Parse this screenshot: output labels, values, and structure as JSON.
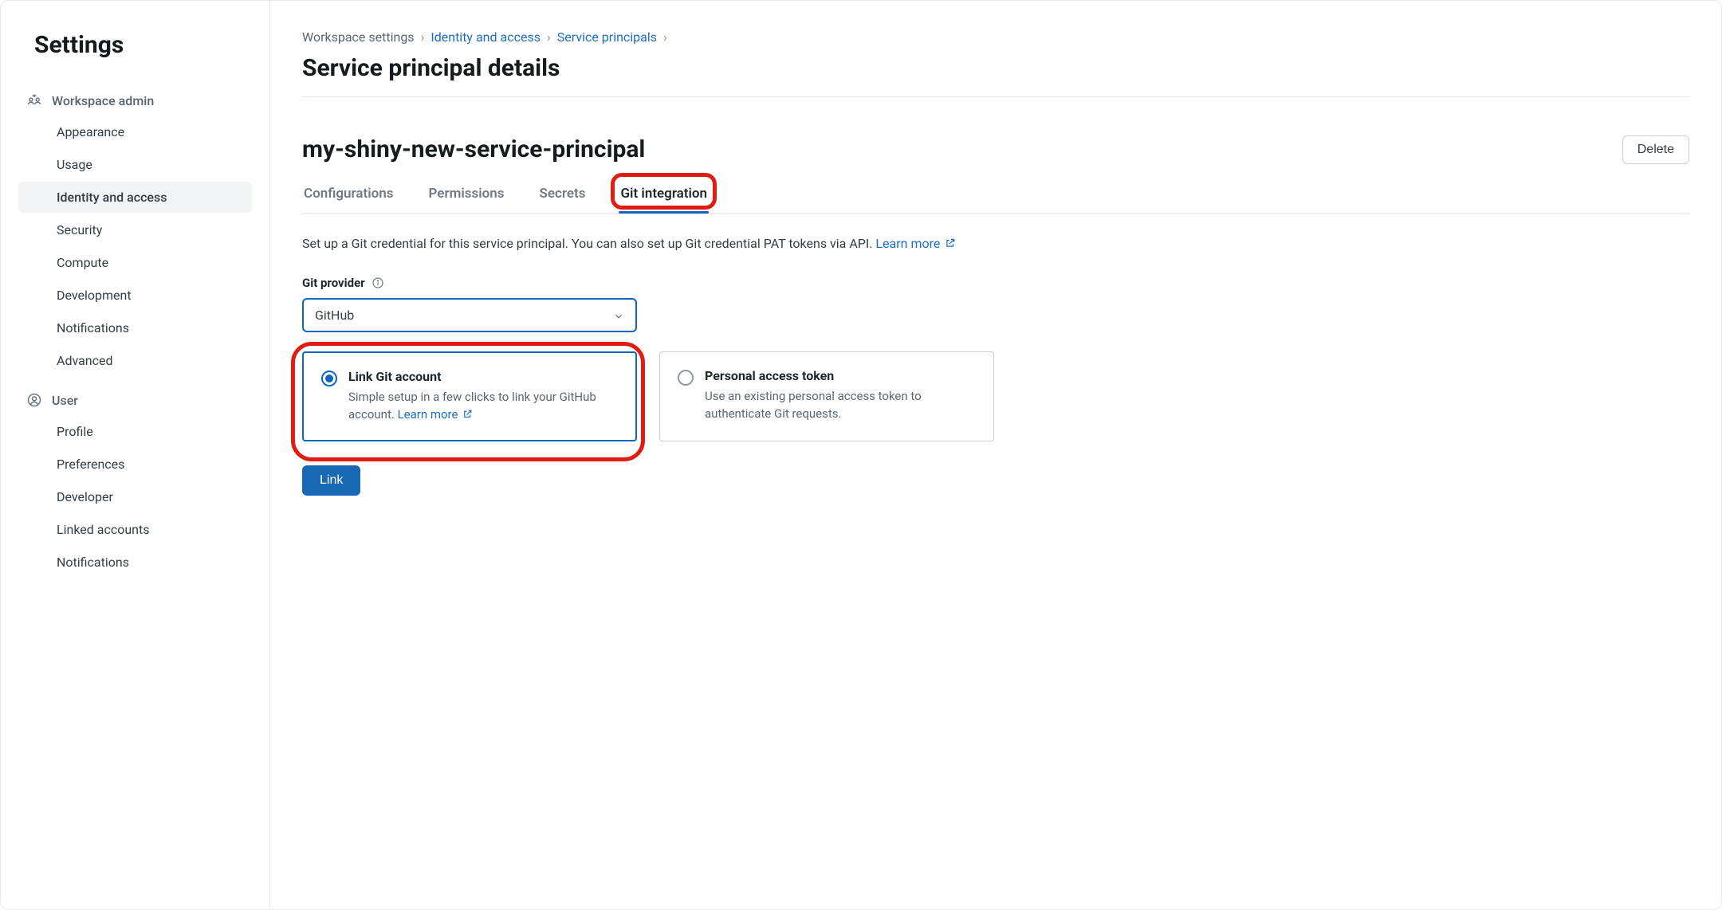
{
  "sidebar": {
    "title": "Settings",
    "sections": [
      {
        "header": "Workspace admin",
        "items": [
          {
            "label": "Appearance",
            "active": false
          },
          {
            "label": "Usage",
            "active": false
          },
          {
            "label": "Identity and access",
            "active": true
          },
          {
            "label": "Security",
            "active": false
          },
          {
            "label": "Compute",
            "active": false
          },
          {
            "label": "Development",
            "active": false
          },
          {
            "label": "Notifications",
            "active": false
          },
          {
            "label": "Advanced",
            "active": false
          }
        ]
      },
      {
        "header": "User",
        "items": [
          {
            "label": "Profile",
            "active": false
          },
          {
            "label": "Preferences",
            "active": false
          },
          {
            "label": "Developer",
            "active": false
          },
          {
            "label": "Linked accounts",
            "active": false
          },
          {
            "label": "Notifications",
            "active": false
          }
        ]
      }
    ]
  },
  "breadcrumb": {
    "items": [
      {
        "label": "Workspace settings",
        "link": false
      },
      {
        "label": "Identity and access",
        "link": true
      },
      {
        "label": "Service principals",
        "link": true
      }
    ]
  },
  "page": {
    "title": "Service principal details",
    "entity_name": "my-shiny-new-service-principal",
    "delete_label": "Delete"
  },
  "tabs": [
    {
      "label": "Configurations",
      "active": false
    },
    {
      "label": "Permissions",
      "active": false
    },
    {
      "label": "Secrets",
      "active": false
    },
    {
      "label": "Git integration",
      "active": true
    }
  ],
  "git": {
    "description": "Set up a Git credential for this service principal. You can also set up Git credential PAT tokens via API.",
    "learn_more": "Learn more",
    "provider_label": "Git provider",
    "provider_value": "GitHub",
    "options": [
      {
        "title": "Link Git account",
        "desc_pre": "Simple setup in a few clicks to link your GitHub account. ",
        "learn_more": "Learn more",
        "selected": true
      },
      {
        "title": "Personal access token",
        "desc_pre": "Use an existing personal access token to authenticate Git requests.",
        "learn_more": "",
        "selected": false
      }
    ],
    "link_button": "Link"
  }
}
